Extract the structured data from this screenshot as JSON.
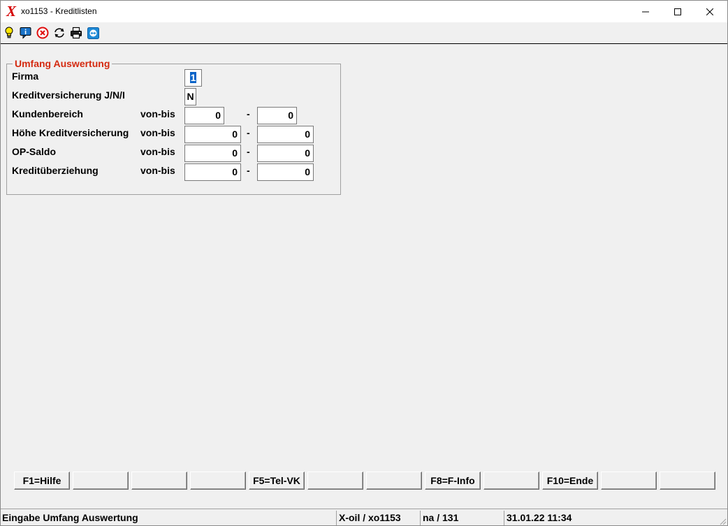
{
  "window": {
    "title": "xo1153 - Kreditlisten",
    "logo_letter": "X",
    "brand_color": "#d40000",
    "controls": [
      "minimize-icon",
      "maximize-icon",
      "close-icon"
    ]
  },
  "toolbar": {
    "icons": [
      "lightbulb-icon",
      "info-icon",
      "cancel-icon",
      "refresh-icon",
      "printer-icon",
      "teamviewer-icon"
    ]
  },
  "form": {
    "group_title": "Umfang Auswertung",
    "group_title_color": "#d42a10",
    "firma": {
      "label": "Firma",
      "value": "1"
    },
    "kreditversicherung": {
      "label": "Kreditversicherung J/N/I",
      "value": "N"
    },
    "range_label": "von-bis",
    "range_separator": "-",
    "rows": [
      {
        "label": "Kundenbereich",
        "range": "von-bis",
        "from": "0",
        "to": "0"
      },
      {
        "label": "Höhe Kreditversicherung",
        "range": "von-bis",
        "from": "0",
        "to": "0"
      },
      {
        "label": "OP-Saldo",
        "range": "von-bis",
        "from": "0",
        "to": "0"
      },
      {
        "label": "Kreditüberziehung",
        "range": "von-bis",
        "from": "0",
        "to": "0"
      }
    ]
  },
  "function_keys": [
    {
      "label": "F1=Hilfe"
    },
    {
      "label": ""
    },
    {
      "label": ""
    },
    {
      "label": ""
    },
    {
      "label": "F5=Tel-VK"
    },
    {
      "label": ""
    },
    {
      "label": ""
    },
    {
      "label": "F8=F-Info"
    },
    {
      "label": ""
    },
    {
      "label": "F10=Ende"
    },
    {
      "label": ""
    },
    {
      "label": ""
    }
  ],
  "status": {
    "message": "Eingabe Umfang Auswertung",
    "program": "X-oil / xo1153",
    "user": "na / 131",
    "datetime": "31.01.22 11:34"
  }
}
